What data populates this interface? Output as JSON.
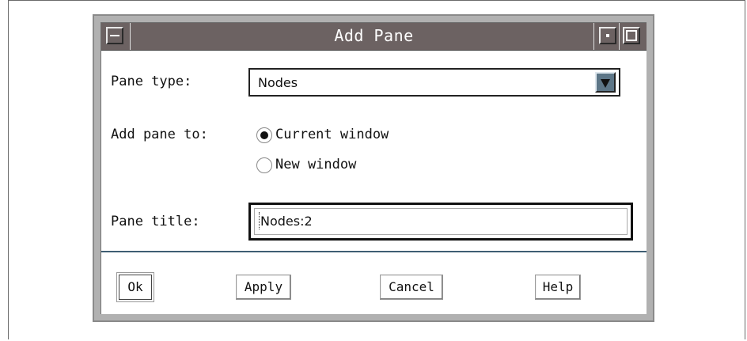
{
  "dialog": {
    "title": "Add Pane"
  },
  "form": {
    "pane_type_label": "Pane type:",
    "pane_type_value": "Nodes",
    "add_pane_to_label": "Add pane to:",
    "radio_options": [
      {
        "label": "Current window",
        "checked": true
      },
      {
        "label": "New window",
        "checked": false
      }
    ],
    "pane_title_label": "Pane title:",
    "pane_title_value": "Nodes:2"
  },
  "buttons": {
    "ok": "Ok",
    "apply": "Apply",
    "cancel": "Cancel",
    "help": "Help"
  },
  "icons": {
    "window_menu": "window-menu-icon",
    "minimize": "minimize-icon",
    "maximize": "maximize-icon",
    "dropdown": "triangle-down-icon"
  },
  "colors": {
    "titlebar": "#6c6262",
    "divider": "#3f5e73",
    "combo_arrow": "#5d7687"
  }
}
